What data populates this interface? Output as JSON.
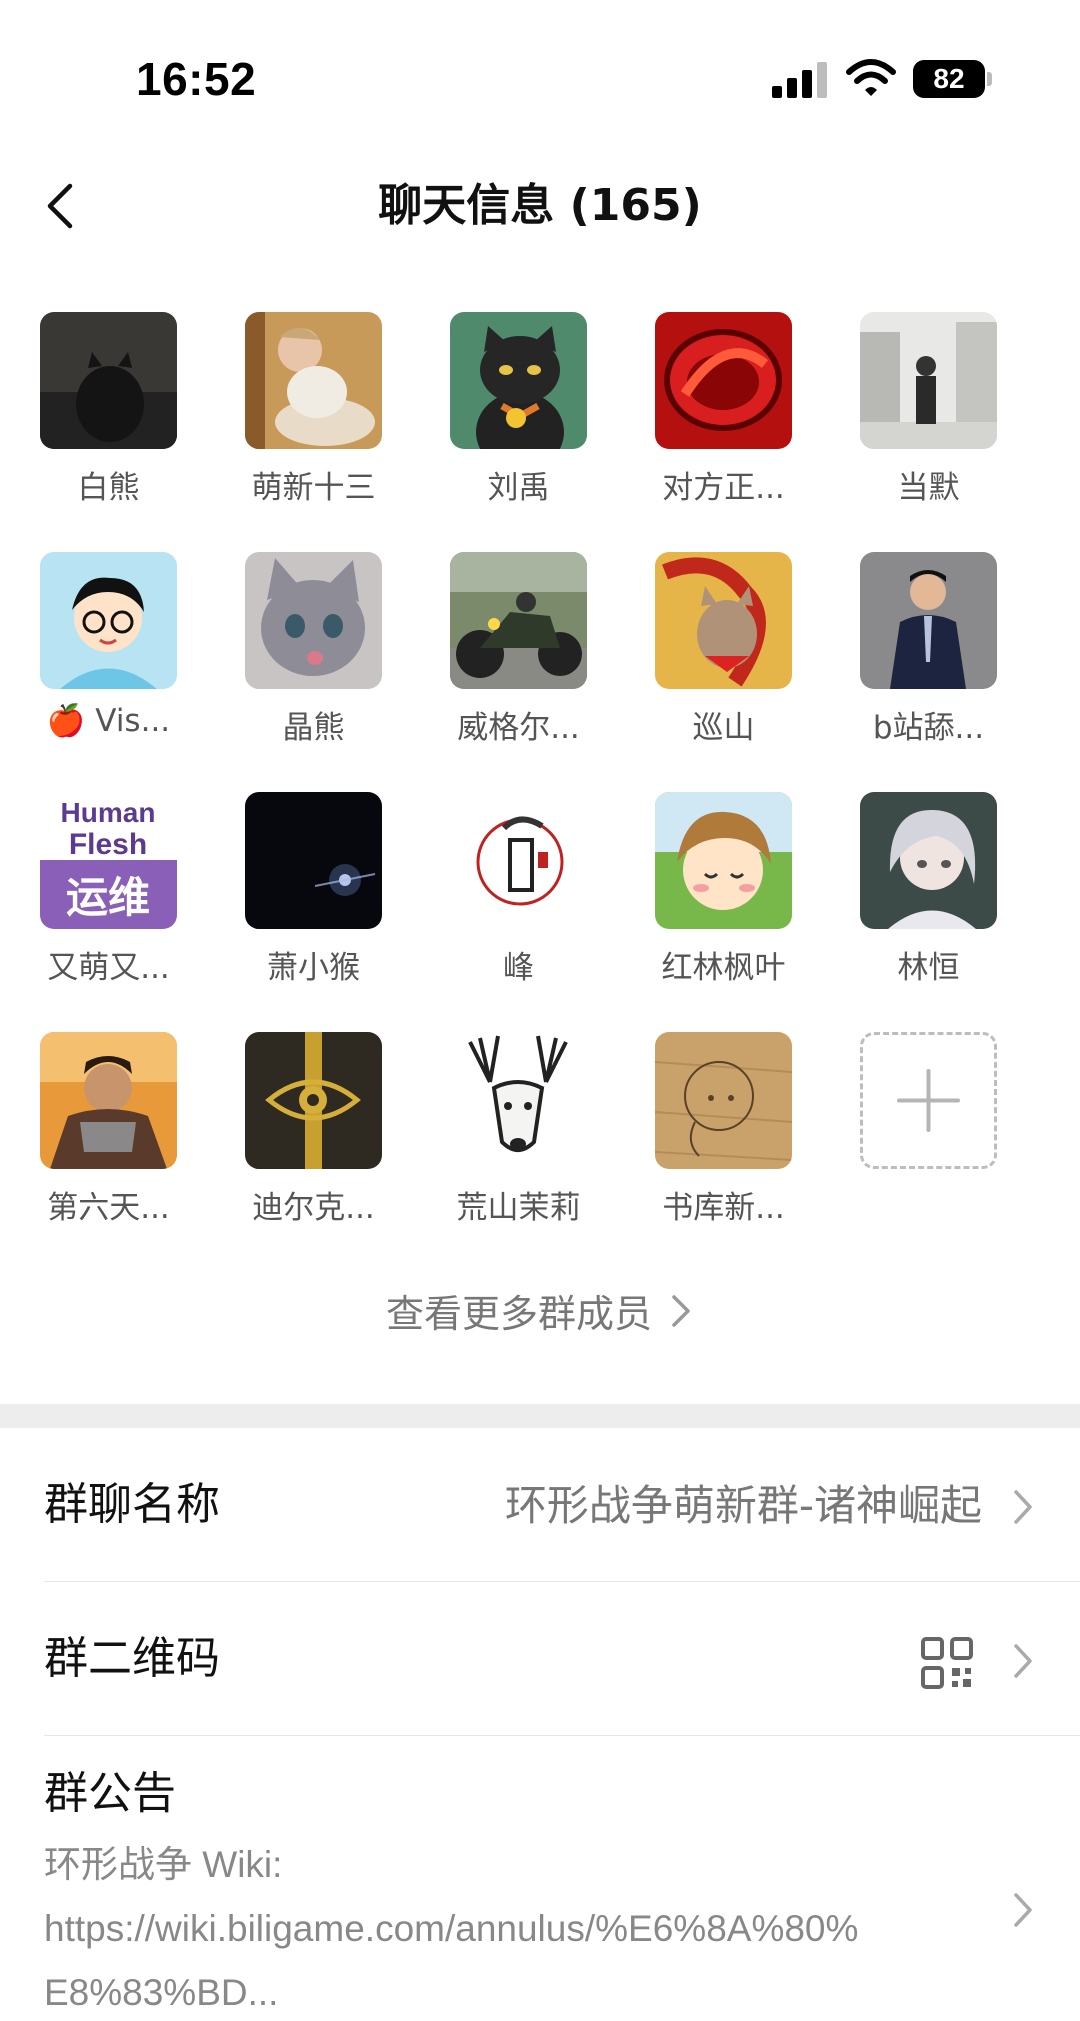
{
  "status_bar": {
    "time": "16:52",
    "battery": "82",
    "icons": [
      "signal-icon",
      "wifi-icon",
      "battery-icon"
    ]
  },
  "nav": {
    "title": "聊天信息 (165)",
    "back_icon": "chevron-left-icon"
  },
  "members": [
    {
      "name": "白熊"
    },
    {
      "name": "萌新十三"
    },
    {
      "name": "刘禹"
    },
    {
      "name": "对方正..."
    },
    {
      "name": "当默"
    },
    {
      "name": "🍎 Vis..."
    },
    {
      "name": "晶熊"
    },
    {
      "name": "威格尔..."
    },
    {
      "name": "巡山"
    },
    {
      "name": "b站舔..."
    },
    {
      "name": "又萌又..."
    },
    {
      "name": "萧小猴"
    },
    {
      "name": "峰"
    },
    {
      "name": "红林枫叶"
    },
    {
      "name": "林恒"
    },
    {
      "name": "第六天..."
    },
    {
      "name": "迪尔克..."
    },
    {
      "name": "荒山茉莉"
    },
    {
      "name": "书库新..."
    }
  ],
  "avatar_texts": {
    "human": "Human",
    "flesh": "Flesh",
    "ops": "运维"
  },
  "add_member_icon": "plus-icon",
  "view_more": "查看更多群成员",
  "group_name": {
    "label": "群聊名称",
    "value": "环形战争萌新群-诸神崛起"
  },
  "qr_code": {
    "label": "群二维码",
    "icon": "qr-code-icon"
  },
  "notice": {
    "label": "群公告",
    "text_line1": "环形战争 Wiki:",
    "text_line2": "https://wiki.biligame.com/annulus/%E6%8A%80%",
    "text_line3": "E8%83%BD..."
  },
  "colors": {
    "background": "#ffffff",
    "section_gap": "#ededed",
    "secondary_text": "#777777"
  }
}
